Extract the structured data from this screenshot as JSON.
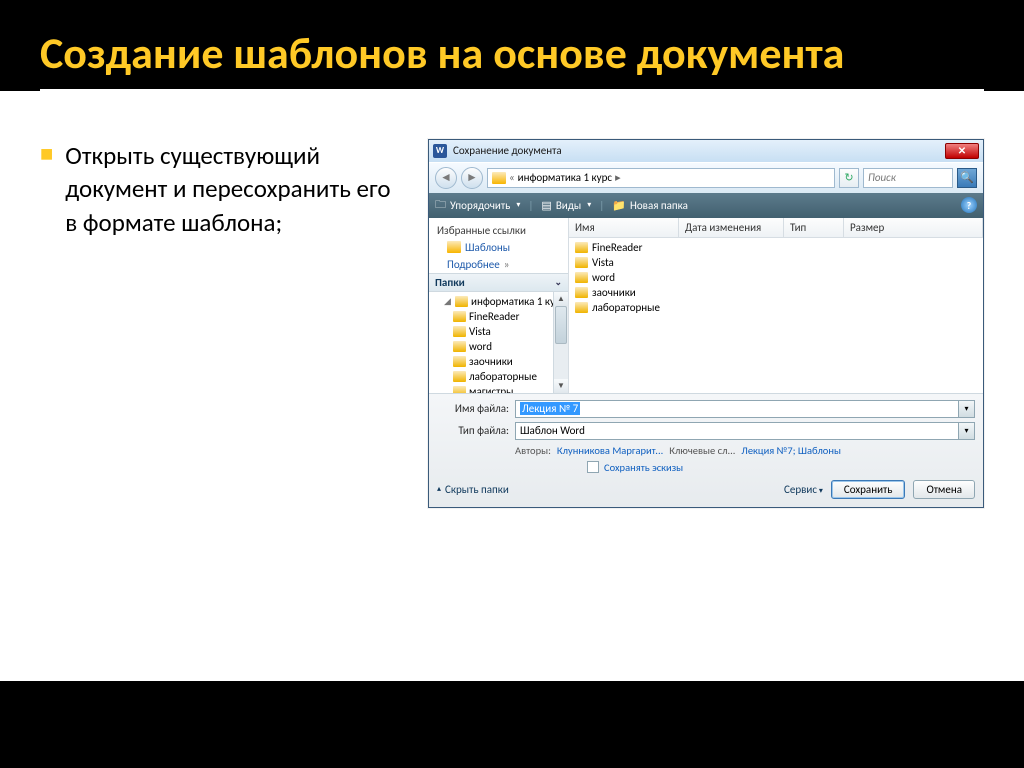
{
  "slide": {
    "title": "Создание шаблонов на основе документа",
    "bullet": "Открыть существующий документ и пересохранить его в формате шаблона;"
  },
  "dialog": {
    "title": "Сохранение документа",
    "breadcrumb": "информатика 1 курс",
    "search_placeholder": "Поиск",
    "toolbar": {
      "organize": "Упорядочить",
      "views": "Виды",
      "new_folder": "Новая папка"
    },
    "sidebar": {
      "favorites_header": "Избранные ссылки",
      "templates": "Шаблоны",
      "more": "Подробнее",
      "folders_header": "Папки"
    },
    "tree": [
      "информатика 1 ку",
      "FineReader",
      "Vista",
      "word",
      "заочники",
      "лабораторные",
      "магистры"
    ],
    "columns": {
      "name": "Имя",
      "date": "Дата изменения",
      "type": "Тип",
      "size": "Размер"
    },
    "files": [
      "FineReader",
      "Vista",
      "word",
      "заочники",
      "лабораторные"
    ],
    "form": {
      "filename_label": "Имя файла:",
      "filename_value": "Лекция № 7",
      "filetype_label": "Тип файла:",
      "filetype_value": "Шаблон Word",
      "authors_label": "Авторы:",
      "authors_value": "Клунникова Маргарит...",
      "keywords_label": "Ключевые сл...",
      "keywords_value": "Лекция №7; Шаблоны",
      "thumb_label": "Сохранять эскизы"
    },
    "footer": {
      "hide_folders": "Скрыть папки",
      "tools": "Сервис",
      "save": "Сохранить",
      "cancel": "Отмена"
    }
  }
}
